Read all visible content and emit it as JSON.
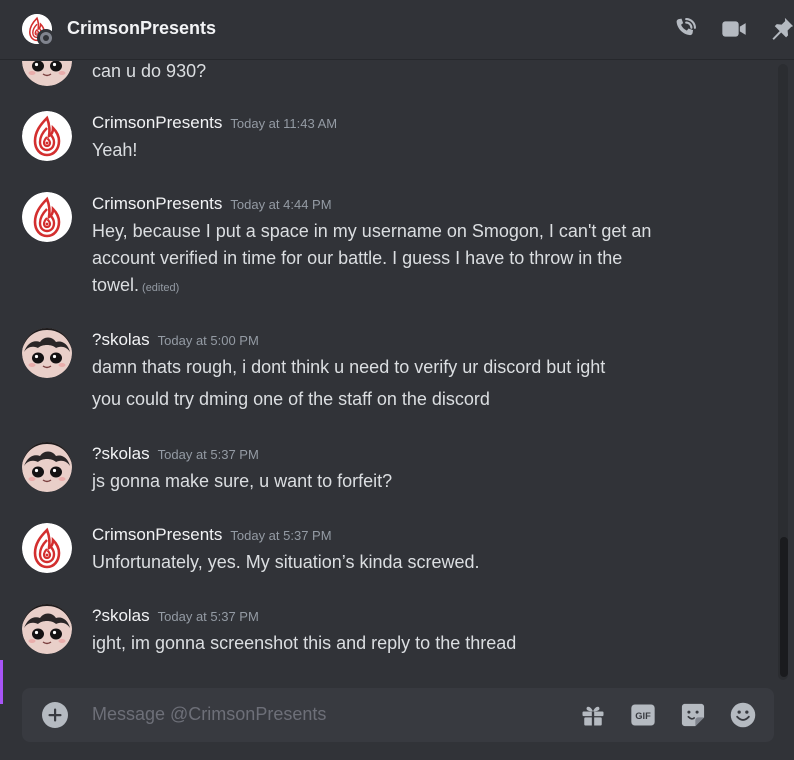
{
  "header": {
    "title": "CrimsonPresents"
  },
  "messages": [
    {
      "author": "",
      "time": "",
      "lines": [
        "can u do 930?"
      ],
      "avatar": "pfp-skolas"
    },
    {
      "author": "CrimsonPresents",
      "time": "Today at 11:43 AM",
      "lines": [
        "Yeah!"
      ],
      "avatar": "pfp-crimson"
    },
    {
      "author": "CrimsonPresents",
      "time": "Today at 4:44 PM",
      "lines": [
        "Hey, because I put a space in my username on Smogon, I can't get an",
        "account verified in time for our battle. I guess I have to throw in the",
        "towel."
      ],
      "edited": "(edited)",
      "avatar": "pfp-crimson"
    },
    {
      "author": "?skolas",
      "time": "Today at 5:00 PM",
      "lines": [
        "damn thats rough, i dont think u need to verify ur discord but ight",
        "you could try dming one of the staff on the discord"
      ],
      "avatar": "pfp-skolas"
    },
    {
      "author": "?skolas",
      "time": "Today at 5:37 PM",
      "lines": [
        "js gonna make sure, u want to forfeit?"
      ],
      "avatar": "pfp-skolas"
    },
    {
      "author": "CrimsonPresents",
      "time": "Today at 5:37 PM",
      "lines": [
        "Unfortunately, yes. My situation’s kinda screwed."
      ],
      "avatar": "pfp-crimson"
    },
    {
      "author": "?skolas",
      "time": "Today at 5:37 PM",
      "lines": [
        "ight, im gonna screenshot this and reply to the thread"
      ],
      "avatar": "pfp-skolas"
    }
  ],
  "composer": {
    "placeholder": "Message @CrimsonPresents"
  },
  "icons": {
    "header": [
      "phone-call-icon",
      "video-call-icon",
      "pin-icon"
    ],
    "composer": [
      "add-attachment-icon",
      "gift-icon",
      "gif-icon",
      "sticker-icon",
      "emoji-icon"
    ]
  },
  "colors": {
    "background": "#313338",
    "composer": "#383a40",
    "accent": "#a855f7",
    "crimson": "#d32f2f"
  }
}
